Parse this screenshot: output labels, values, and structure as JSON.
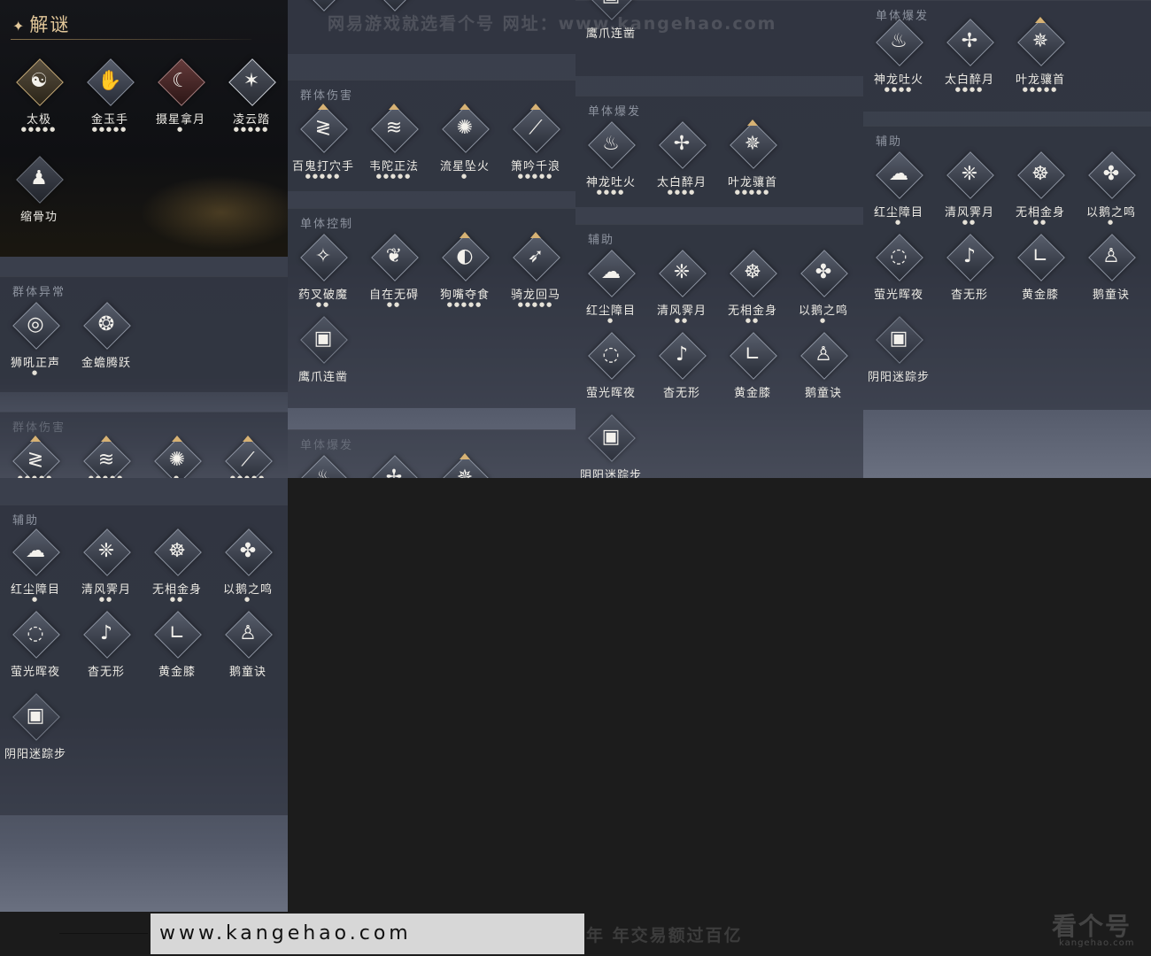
{
  "puzzle": {
    "title": "解谜",
    "skills": [
      {
        "name": "太极",
        "dots": "●●●●●",
        "icon": "☯"
      },
      {
        "name": "金玉手",
        "dots": "●●●●●",
        "icon": "✋"
      },
      {
        "name": "摄星拿月",
        "dots": "●",
        "icon": "☾"
      },
      {
        "name": "凌云踏",
        "dots": "●●●●●",
        "icon": "✶"
      },
      {
        "name": "缩骨功",
        "dots": "",
        "icon": "♟"
      }
    ]
  },
  "sections": {
    "group_abnormal": {
      "title": "群体异常",
      "skills": [
        {
          "name": "狮吼正声",
          "dots": "●"
        },
        {
          "name": "金蟾腾跃",
          "dots": ""
        }
      ]
    },
    "group_damage": {
      "title": "群体伤害",
      "skills": [
        {
          "name": "百鬼打穴手",
          "dots": "●●●●●"
        },
        {
          "name": "韦陀正法",
          "dots": "●●●●●"
        },
        {
          "name": "流星坠火",
          "dots": "●"
        },
        {
          "name": "箫吟千浪",
          "dots": "●●●●●"
        }
      ]
    },
    "single_control": {
      "title": "单体控制",
      "skills": [
        {
          "name": "药叉破魔",
          "dots": "●●"
        },
        {
          "name": "自在无碍",
          "dots": "●●"
        },
        {
          "name": "狗嘴夺食",
          "dots": "●●●●●"
        },
        {
          "name": "骑龙回马",
          "dots": "●●●●●"
        },
        {
          "name": "鹰爪连凿",
          "dots": ""
        }
      ]
    },
    "single_burst": {
      "title": "单体爆发",
      "skills": [
        {
          "name": "神龙吐火",
          "dots": "●●●●"
        },
        {
          "name": "太白醉月",
          "dots": "●●●●"
        },
        {
          "name": "叶龙骧首",
          "dots": "●●●●●"
        }
      ]
    },
    "support": {
      "title": "辅助",
      "skills": [
        {
          "name": "红尘障目",
          "dots": "●"
        },
        {
          "name": "清风霁月",
          "dots": "●●"
        },
        {
          "name": "无相金身",
          "dots": "●●"
        },
        {
          "name": "以鹅之鸣",
          "dots": "●"
        },
        {
          "name": "萤光晖夜",
          "dots": ""
        },
        {
          "name": "杳无形",
          "dots": ""
        },
        {
          "name": "黄金膝",
          "dots": ""
        },
        {
          "name": "鹅童诀",
          "dots": ""
        },
        {
          "name": "阴阳迷踪步",
          "dots": ""
        }
      ]
    }
  },
  "watermark": {
    "top": "网易游戏就选看个号   网址：www.kangehao.com",
    "bottom": "看个号专业网易游戏八年  年交易额过百亿",
    "url": "www.kangehao.com",
    "logo": "看个号",
    "logo_sub": "kangehao.com"
  }
}
